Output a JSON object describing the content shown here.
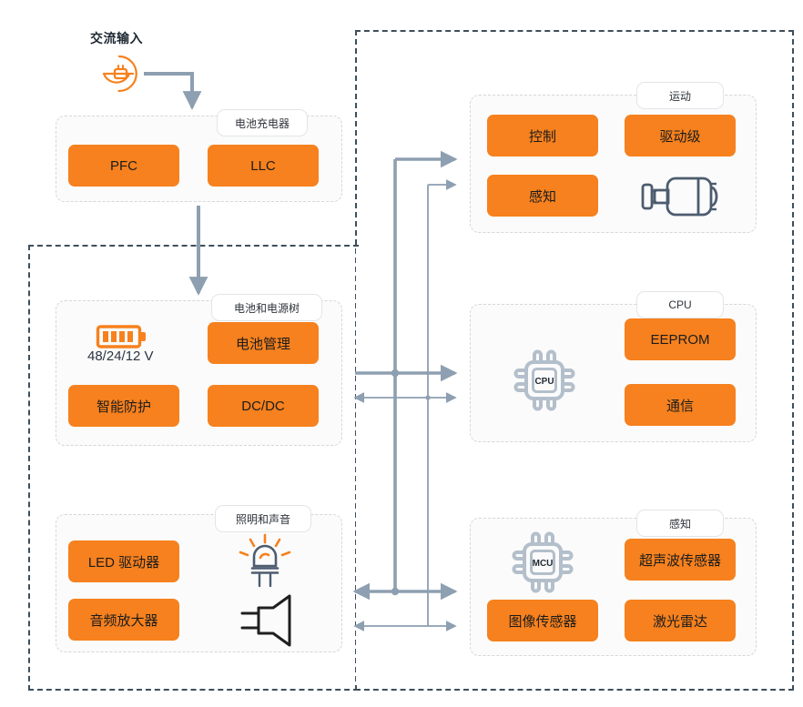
{
  "diagram": {
    "title_ac_input": "交流输入",
    "colors": {
      "accent_orange": "#F6811E",
      "wire_gray": "#8d9fb0",
      "border_dark": "#3D4F5C",
      "panel_border": "#D4D7DA",
      "chip_gray": "#B3BFCA",
      "icon_slate": "#4D5C6E"
    },
    "groups": [
      {
        "id": "battery-charger",
        "label": "电池充电器",
        "blocks": [
          "PFC",
          "LLC"
        ]
      },
      {
        "id": "battery-power-tree",
        "label": "电池和电源树",
        "blocks": [
          "电池管理",
          "智能防护",
          "DC/DC"
        ],
        "battery_voltage": "48/24/12 V"
      },
      {
        "id": "lighting-sound",
        "label": "照明和声音",
        "blocks": [
          "LED 驱动器",
          "音频放大器"
        ]
      },
      {
        "id": "motion",
        "label": "运动",
        "blocks": [
          "控制",
          "驱动级",
          "感知"
        ]
      },
      {
        "id": "cpu",
        "label": "CPU",
        "blocks": [
          "EEPROM",
          "通信"
        ],
        "chip_label": "CPU"
      },
      {
        "id": "sensing",
        "label": "感知",
        "blocks": [
          "超声波传感器",
          "图像传感器",
          "激光雷达"
        ],
        "chip_label": "MCU"
      }
    ],
    "icons": [
      {
        "name": "ac-plug-icon",
        "group": "ac-input"
      },
      {
        "name": "battery-icon",
        "group": "battery-power-tree"
      },
      {
        "name": "led-lamp-icon",
        "group": "lighting-sound"
      },
      {
        "name": "speaker-icon",
        "group": "lighting-sound"
      },
      {
        "name": "motor-icon",
        "group": "motion"
      },
      {
        "name": "cpu-chip-icon",
        "group": "cpu"
      },
      {
        "name": "mcu-chip-icon",
        "group": "sensing"
      }
    ]
  }
}
